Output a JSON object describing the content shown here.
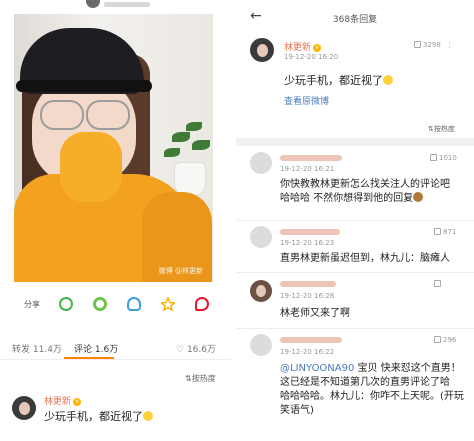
{
  "left": {
    "photo_watermark": "微博 @林更新",
    "actions": [
      {
        "label": "分享",
        "icon": "share-icon"
      },
      {
        "icon": "wechat-icon"
      },
      {
        "icon": "moments-icon"
      },
      {
        "icon": "qq-icon"
      },
      {
        "icon": "qzone-icon"
      },
      {
        "icon": "weibo-icon"
      }
    ],
    "stats": {
      "repost_label": "转发",
      "repost_count": "11.4万",
      "comment_label": "评论",
      "comment_count": "1.6万",
      "like_count": "16.6万"
    },
    "sort_label": "按热度",
    "comment": {
      "user": "林更新",
      "text": "少玩手机，都近视了"
    }
  },
  "right": {
    "title": "368条回复",
    "main": {
      "user": "林更新",
      "likes": "3298",
      "time": "19-12-20 16:20",
      "text": "少玩手机，都近视了",
      "link": "查看原微博"
    },
    "sort_label": "按热度",
    "replies": [
      {
        "likes": "1010",
        "time": "19-12-20 16:21",
        "lines": [
          "你快教教林更新怎么找关注人的评论吧",
          "哈哈哈 不然你想得到他的回复"
        ]
      },
      {
        "likes": "871",
        "time": "19-12-20 16:23",
        "lines": [
          "直男林更新虽迟但到，林九儿：脑瘫人"
        ]
      },
      {
        "likes": "",
        "time": "19-12-20 16:28",
        "lines": [
          "林老师又来了啊"
        ]
      },
      {
        "likes": "296",
        "time": "19-12-20 16:22",
        "mention": "@LINYOONA90",
        "lines_after_mention": "宝贝  快来怼这个直男！",
        "lines": [
          "这已经是不知道第几次的直男评论了哈",
          "哈哈哈哈。林九儿：你咋不上天呢。(开玩",
          "笑语气)"
        ]
      }
    ]
  }
}
